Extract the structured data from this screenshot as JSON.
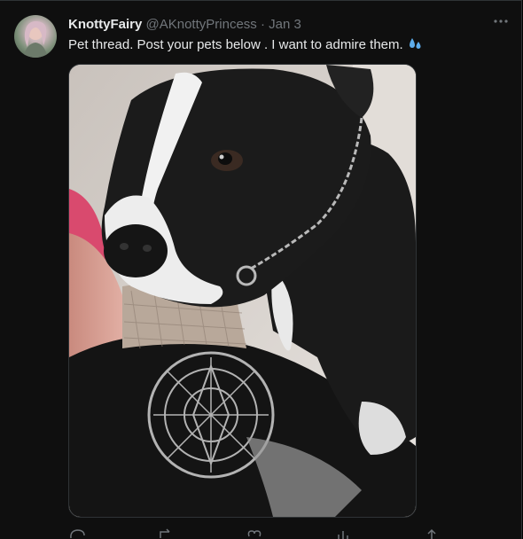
{
  "tweet": {
    "display_name": "KnottyFairy",
    "handle": "@AKnottyPrincess",
    "separator": "·",
    "date": "Jan 3",
    "text": "Pet thread.  Post your pets below . I want to admire them.",
    "emoji": "sweat-droplets-emoji",
    "more_icon": "more-horizontal-icon",
    "media_subject": "dog-photo",
    "accent_color": "#1d9bf0"
  },
  "actions": [
    {
      "name": "reply-icon"
    },
    {
      "name": "retweet-icon"
    },
    {
      "name": "like-icon"
    },
    {
      "name": "views-icon"
    },
    {
      "name": "share-icon"
    }
  ]
}
